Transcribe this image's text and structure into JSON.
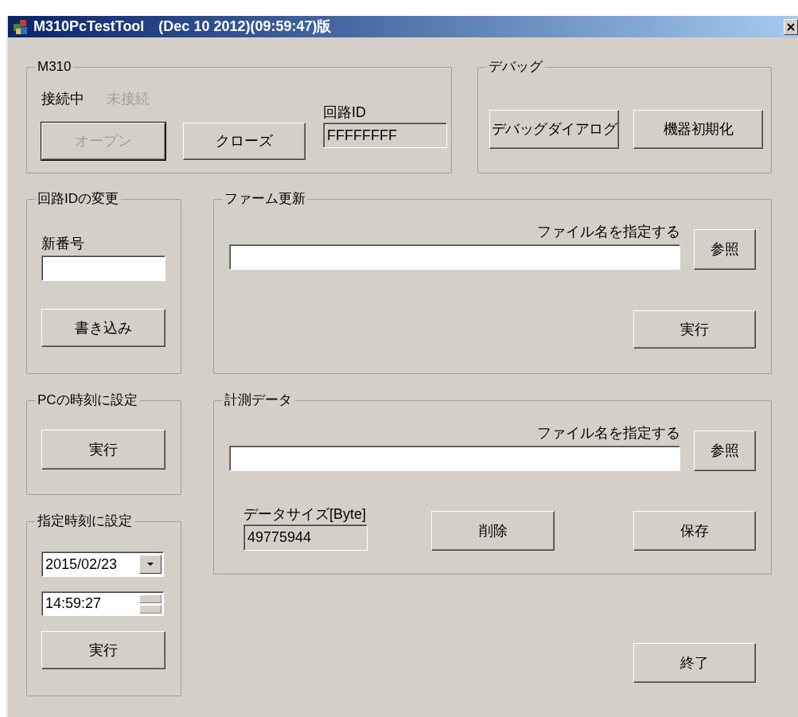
{
  "window": {
    "title": "M310PcTestTool　(Dec 10 2012)(09:59:47)版"
  },
  "m310": {
    "legend": "M310",
    "status": [
      {
        "label": "接続中",
        "active": true
      },
      {
        "label": "未接続",
        "active": false
      }
    ],
    "buttons": [
      {
        "label": "オープン",
        "disabled": true,
        "default": true
      },
      {
        "label": "クローズ",
        "disabled": false,
        "default": false
      }
    ],
    "circuit_id": {
      "label": "回路ID",
      "value": "FFFFFFFF"
    }
  },
  "debug": {
    "legend": "デバッグ",
    "buttons": [
      "デバッグダイアログ",
      "機器初期化"
    ]
  },
  "change_id": {
    "legend": "回路IDの変更",
    "field_label": "新番号",
    "button": "書き込み"
  },
  "firmware": {
    "legend": "ファーム更新",
    "file_label": "ファイル名を指定する",
    "browse": "参照",
    "run": "実行"
  },
  "pc_time": {
    "legend": "PCの時刻に設定",
    "run": "実行"
  },
  "measurement": {
    "legend": "計測データ",
    "file_label": "ファイル名を指定する",
    "browse": "参照",
    "size_label": "データサイズ[Byte]",
    "size_value": "49775944",
    "delete": "削除",
    "save": "保存"
  },
  "set_time": {
    "legend": "指定時刻に設定",
    "date": "2015/02/23",
    "time": "14:59:27",
    "run": "実行"
  },
  "exit": "終了"
}
